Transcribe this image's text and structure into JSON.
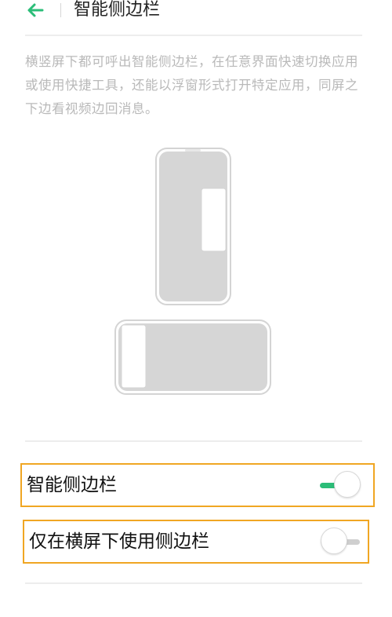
{
  "header": {
    "back_icon": "arrow-left-icon",
    "title": "智能侧边栏"
  },
  "description": "横竖屏下都可呼出智能侧边栏，在任意界面快速切换应用或使用快捷工具，还能以浮窗形式打开特定应用，同屏之下边看视频边回消息。",
  "settings": [
    {
      "label": "智能侧边栏",
      "enabled": true
    },
    {
      "label": "仅在横屏下使用侧边栏",
      "enabled": false
    }
  ],
  "colors": {
    "accent": "#2bbd78",
    "highlight": "#f0a623",
    "toggle_off_track": "#cfcfcf"
  }
}
